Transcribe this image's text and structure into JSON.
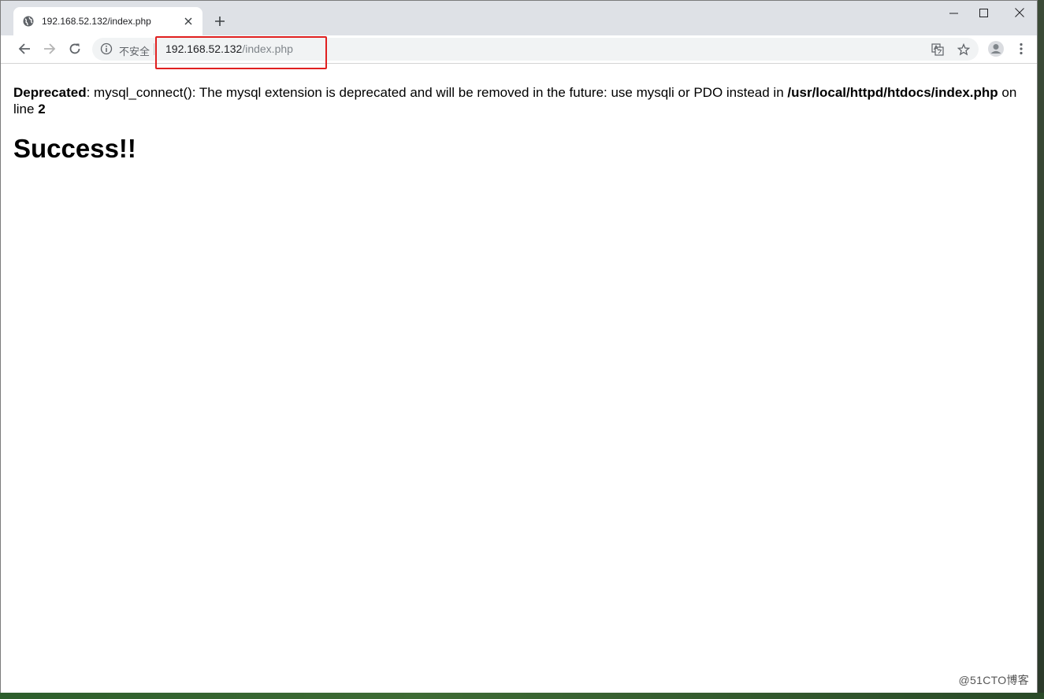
{
  "browser": {
    "tab": {
      "title": "192.168.52.132/index.php",
      "favicon": "globe-icon"
    },
    "new_tab_symbol": "+",
    "window_controls": [
      "minimize-icon",
      "maximize-icon",
      "close-icon"
    ],
    "nav": [
      "back-icon",
      "forward-icon",
      "reload-icon"
    ],
    "omnibox": {
      "security_label": "不安全",
      "url_host": "192.168.52.132",
      "url_path": "/index.php",
      "icons": [
        "translate-icon",
        "star-icon"
      ]
    },
    "profile_icon": "avatar-icon",
    "menu_icon": "more-vert-icon",
    "highlight_color": "#e02020"
  },
  "page": {
    "warning": {
      "label": "Deprecated",
      "message": ": mysql_connect(): The mysql extension is deprecated and will be removed in the future: use mysqli or PDO instead in ",
      "file": "/usr/local/httpd/htdocs/index.php",
      "line_prefix": " on line ",
      "line_number": "2"
    },
    "heading": "Success!!"
  },
  "watermark": "@51CTO博客"
}
